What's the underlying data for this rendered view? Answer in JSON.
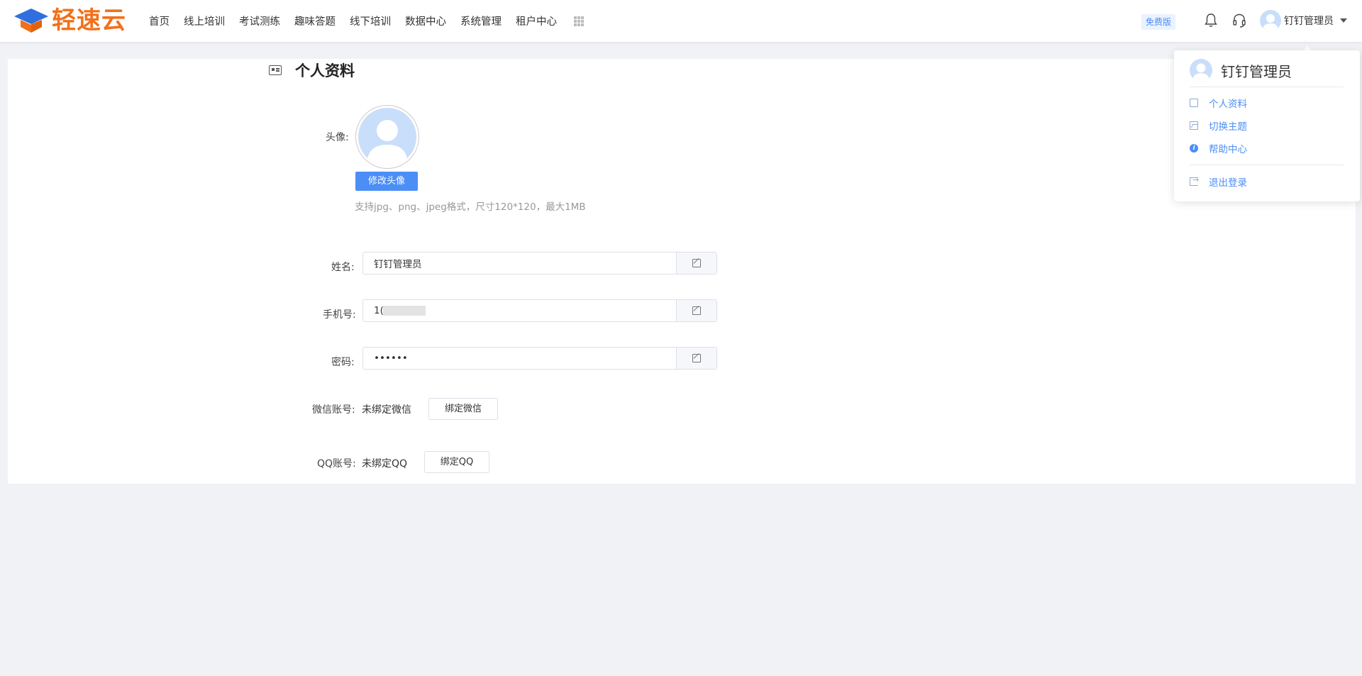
{
  "brand": {
    "name": "轻速云",
    "color": "#f2701b"
  },
  "nav": {
    "items": [
      "首页",
      "线上培训",
      "考试测练",
      "趣味答题",
      "线下培训",
      "数据中心",
      "系统管理",
      "租户中心"
    ],
    "apps_icon": "grid-icon"
  },
  "header": {
    "plan_badge": "免费版",
    "bell_icon": "bell-icon",
    "support_icon": "headset-icon",
    "user_name": "钉钉管理员"
  },
  "page": {
    "title": "个人资料",
    "avatar_label": "头像:",
    "change_avatar_button": "修改头像",
    "avatar_hint": "支持jpg、png、jpeg格式，尺寸120*120，最大1MB",
    "name_label": "姓名:",
    "name_value": "钉钉管理员",
    "phone_label": "手机号:",
    "phone_value": "1(",
    "password_label": "密码:",
    "password_value": "••••••",
    "wechat_label": "微信账号:",
    "wechat_value": "未绑定微信",
    "wechat_button": "绑定微信",
    "qq_label": "QQ账号:",
    "qq_value": "未绑定QQ",
    "qq_button": "绑定QQ"
  },
  "dropdown": {
    "user_name": "钉钉管理员",
    "items": [
      {
        "label": "个人资料",
        "icon": "id-card-icon"
      },
      {
        "label": "切换主题",
        "icon": "image-icon"
      },
      {
        "label": "帮助中心",
        "icon": "info-icon"
      }
    ],
    "logout": {
      "label": "退出登录",
      "icon": "logout-icon"
    }
  },
  "colors": {
    "accent": "#4b8ef6",
    "background": "#f0f2f5"
  }
}
